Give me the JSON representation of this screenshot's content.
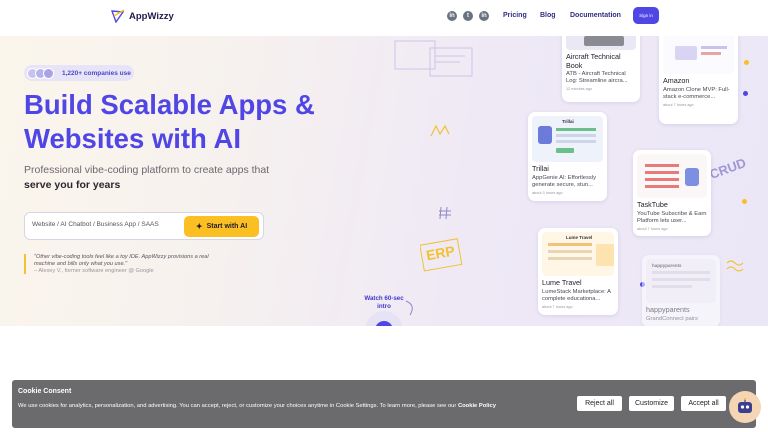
{
  "header": {
    "brand": "AppWizzy",
    "socials": [
      "linkedin",
      "twitter",
      "linkedin"
    ],
    "nav": [
      "Pricing",
      "Blog",
      "Documentation"
    ],
    "signin_label": "Sign in"
  },
  "hero": {
    "companies": "1,220+ companies use",
    "headline": "Build Scalable Apps & Websites with AI",
    "sub_plain": "Professional vibe-coding platform to create apps that",
    "sub_bold": "serve you for years",
    "search_placeholder": "Website / AI Chatbot / Business App / SAAS",
    "start_label": "Start with AI",
    "quote": "\"Other vibe-coding tools feel like a toy IDE. AppWizzy provisions a real machine and bills only what you use.\"",
    "quote_author": "– Alexey V., former software engineer @ Google",
    "intro_label": "Watch 60-sec intro"
  },
  "cards": [
    {
      "title": "Aircraft Technical Book",
      "desc": "ATB - Aircraft Technical Log: Streamline aircra...",
      "time": "12 minutes ago"
    },
    {
      "title": "Amazon",
      "desc": "Amazon Clone MVP: Full-stack e-commerce...",
      "time": "about 7 hours ago"
    },
    {
      "title": "Trillai",
      "desc": "AppGenie AI: Effortlessly generate secure, stun...",
      "time": "about 3 hours ago"
    },
    {
      "title": "TaskTube",
      "desc": "YouTube Subscribe & Earn Platform lets user...",
      "time": "about 7 hours ago"
    },
    {
      "title": "Lume Travel",
      "desc": "LumeStack Marketplace: A complete educationa...",
      "time": "about 7 hours ago"
    },
    {
      "title": "happyparents",
      "desc": "GrandConnect pairs",
      "time": ""
    }
  ],
  "thumb_labels": {
    "trillai": "Trillai",
    "lume": "Lume Travel",
    "happy": "happyparents"
  },
  "doodles": {
    "erp": "ERP",
    "crud": "CRUD"
  },
  "cookie": {
    "title": "Cookie Consent",
    "text": "We use cookies for analytics, personalization, and advertising. You can accept, reject, or customize your choices anytime in Cookie Settings. To learn more, please see our",
    "link": "Cookie Policy",
    "reject": "Reject all",
    "customize": "Customize",
    "accept": "Accept all"
  },
  "colors": {
    "primary": "#4f46e5",
    "accent": "#fbbf24"
  }
}
